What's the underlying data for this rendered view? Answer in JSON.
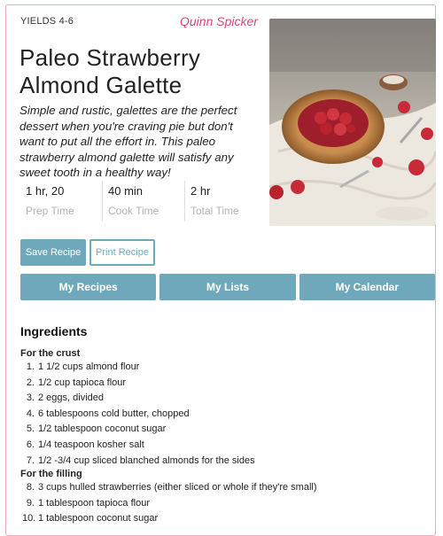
{
  "recipe": {
    "yields": "YIELDS 4-6",
    "author": "Quinn Spicker",
    "title": "Paleo Strawberry Almond Galette",
    "summary": "Simple and rustic, galettes are the perfect dessert when you're craving pie but don't want to put all the effort in. This paleo strawberry almond galette will satisfy any sweet tooth in a healthy way!",
    "times": [
      {
        "value": "1 hr, 20",
        "label": "Prep Time"
      },
      {
        "value": "40 min",
        "label": "Cook Time"
      },
      {
        "value": "2 hr",
        "label": "Total Time"
      }
    ]
  },
  "actions": {
    "save_label": "Save Recipe",
    "print_label": "Print Recipe"
  },
  "nav": {
    "recipes_label": "My Recipes",
    "lists_label": "My Lists",
    "calendar_label": "My Calendar"
  },
  "ingredients": {
    "heading": "Ingredients",
    "crust_label": "For the crust",
    "filling_label": "For the filling",
    "crust": [
      {
        "num": "1.",
        "text": "1 1/2 cups almond flour"
      },
      {
        "num": "2.",
        "text": "1/2 cup tapioca flour"
      },
      {
        "num": "3.",
        "text": "2 eggs, divided"
      },
      {
        "num": "4.",
        "text": "6 tablespoons cold butter, chopped"
      },
      {
        "num": "5.",
        "text": "1/2 tablespoon coconut sugar"
      },
      {
        "num": "6.",
        "text": "1/4 teaspoon kosher salt"
      },
      {
        "num": "7.",
        "text": "1/2 -3/4 cup sliced blanched almonds for the sides"
      }
    ],
    "filling": [
      {
        "num": "8.",
        "text": "3 cups hulled strawberries (either sliced or whole if they're small)"
      },
      {
        "num": "9.",
        "text": "1 tablespoon tapioca flour"
      },
      {
        "num": "10.",
        "text": "1 tablespoon coconut sugar"
      }
    ]
  },
  "colors": {
    "accent": "#6fa8bb",
    "author": "#d9467b",
    "border": "#e9a9be"
  }
}
